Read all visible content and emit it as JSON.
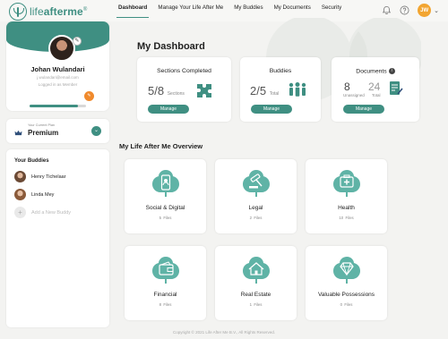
{
  "brand": {
    "name_light": "life",
    "name_bold": "afterme",
    "reg": "®"
  },
  "nav": {
    "items": [
      "Dashboard",
      "Manage Your Life After Me",
      "My Buddies",
      "My Documents",
      "Security"
    ],
    "active": "Dashboard"
  },
  "user": {
    "initials": "JW"
  },
  "profile": {
    "name": "Johan Wulandari",
    "email": "j.wulandari@email.com",
    "status": "Logged in as Member",
    "progress_fraction": 0.85
  },
  "plan": {
    "label": "Your Current Plan",
    "value": "Premium"
  },
  "buddies": {
    "title": "Your Buddies",
    "list": [
      {
        "name": "Henry Tichelaar"
      },
      {
        "name": "Linda Mey"
      }
    ],
    "add_label": "Add a New Buddy"
  },
  "dashboard": {
    "title": "My Dashboard",
    "sections": {
      "title": "Sections Completed",
      "completed": "5",
      "total": "8",
      "suffix": "Sections",
      "button": "Manage"
    },
    "buddies": {
      "title": "Buddies",
      "count": "2",
      "total": "5",
      "suffix": "Total",
      "button": "Manage"
    },
    "documents": {
      "title": "Documents",
      "unassigned": "8",
      "unassigned_label": "Unassigned",
      "total": "24",
      "total_label": "Total",
      "button": "Manage"
    }
  },
  "overview": {
    "title": "My Life After Me Overview",
    "tiles": [
      {
        "label": "Social & Digital",
        "files": "5",
        "files_label": "Files",
        "icon": "phone-icon"
      },
      {
        "label": "Legal",
        "files": "2",
        "files_label": "Files",
        "icon": "gavel-icon"
      },
      {
        "label": "Health",
        "files": "10",
        "files_label": "Files",
        "icon": "medical-kit-icon"
      },
      {
        "label": "Financial",
        "files": "8",
        "files_label": "Files",
        "icon": "wallet-icon"
      },
      {
        "label": "Real Estate",
        "files": "1",
        "files_label": "Files",
        "icon": "house-icon"
      },
      {
        "label": "Valuable Possessions",
        "files": "0",
        "files_label": "Files",
        "icon": "diamond-icon"
      }
    ]
  },
  "footer": {
    "text": "Copyright © 2021 Life After Me B.V., All Rights Reserved."
  },
  "colors": {
    "accent": "#3f8f82",
    "orange": "#f2a531",
    "background": "#f3f3f1",
    "tile_icon_bg": "#5fb3a6"
  }
}
